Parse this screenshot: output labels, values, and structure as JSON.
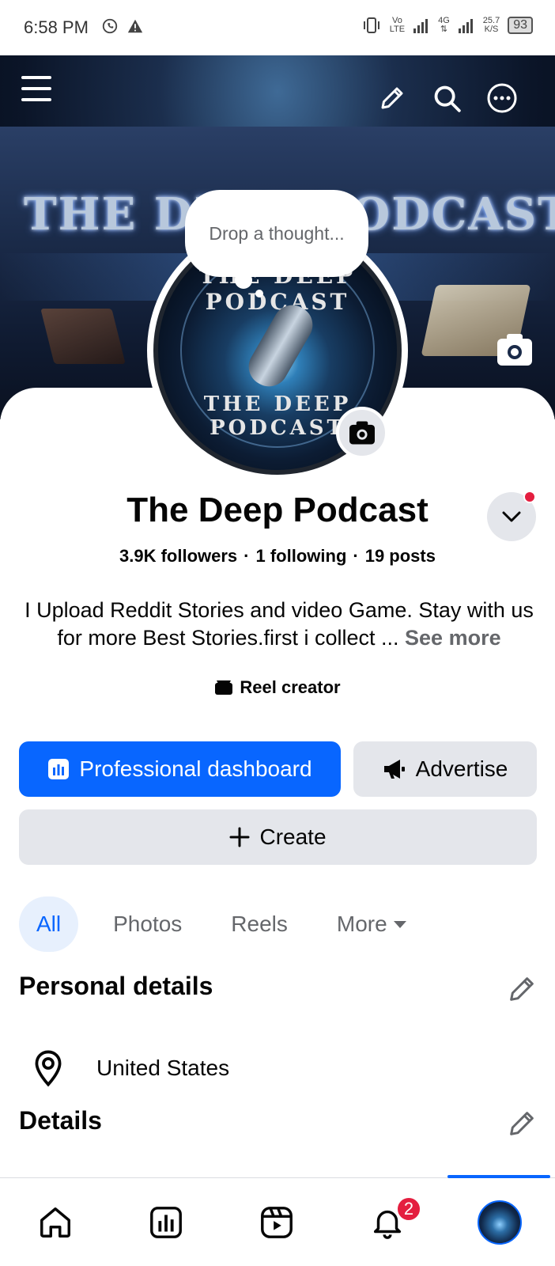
{
  "status_bar": {
    "time": "6:58 PM",
    "net_speed_value": "25.7",
    "net_speed_unit": "K/S",
    "net_type": "4G",
    "volte": "Vo",
    "lte": "LTE",
    "battery": "93"
  },
  "cover": {
    "title_text": "THE DEEP PODCAST"
  },
  "thought_bubble": {
    "placeholder": "Drop a thought..."
  },
  "avatar": {
    "text_top": "THE DEEP PODCAST",
    "text_bottom": "THE DEEP PODCAST"
  },
  "profile": {
    "name": "The Deep Podcast",
    "followers": "3.9K followers",
    "following": "1 following",
    "posts": "19 posts",
    "bio": "I Upload Reddit Stories and video Game. Stay with us for more Best Stories.first i collect ...",
    "see_more": "See more",
    "badge": "Reel creator"
  },
  "buttons": {
    "dashboard": "Professional dashboard",
    "advertise": "Advertise",
    "create": "Create"
  },
  "tabs": [
    {
      "label": "All",
      "active": true
    },
    {
      "label": "Photos",
      "active": false
    },
    {
      "label": "Reels",
      "active": false
    },
    {
      "label": "More",
      "active": false
    }
  ],
  "sections": {
    "personal_details": "Personal details",
    "location": "United States",
    "details": "Details"
  },
  "bottom_nav": {
    "notifications_count": "2",
    "items": [
      "home-icon",
      "dashboard-icon",
      "video-icon",
      "bell-icon",
      "profile-avatar"
    ]
  },
  "colors": {
    "accent": "#0866ff",
    "badge_red": "#e41e3f",
    "secondary_button": "#e4e6eb",
    "muted_text": "#65676b"
  }
}
